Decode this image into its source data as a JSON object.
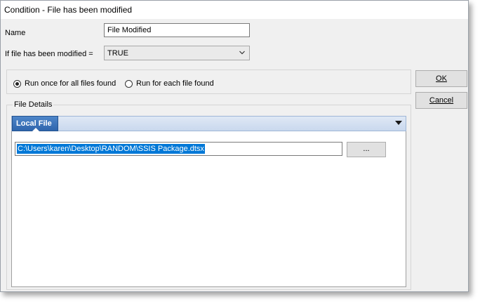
{
  "window": {
    "title": "Condition - File has been modified"
  },
  "form": {
    "name_label": "Name",
    "name_value": "File Modified",
    "modified_label": "If file has been modified =",
    "modified_value": "TRUE"
  },
  "run_options": {
    "option1_label": "Run once for all files found",
    "option1_checked": true,
    "option2_label": "Run for each file found",
    "option2_checked": false
  },
  "buttons": {
    "ok_label": "OK",
    "cancel_label": "Cancel"
  },
  "file_details": {
    "group_label": "File Details",
    "tab_label": "Local File",
    "path_value": "C:\\Users\\karen\\Desktop\\RANDOM\\SSIS Package.dtsx",
    "browse_label": "..."
  },
  "icons": {
    "combo_arrow": "chevron-down-icon",
    "tab_menu": "dropdown-triangle-icon"
  },
  "colors": {
    "selection": "#0078d7",
    "tab_active": "#2f65ad"
  }
}
